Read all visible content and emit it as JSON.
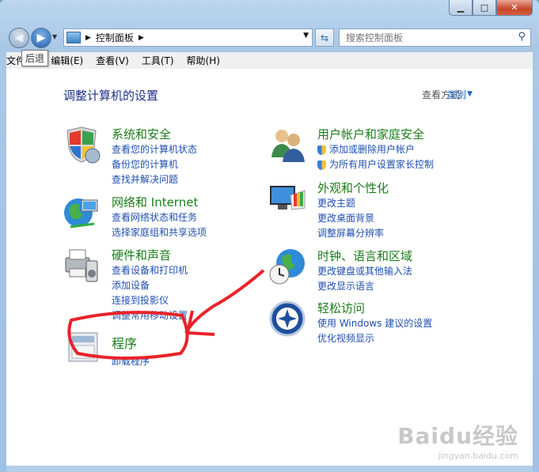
{
  "window": {
    "title_controls": {
      "minimize": "▁",
      "maximize": "□",
      "close": "✕"
    }
  },
  "nav": {
    "back_tooltip": "后退",
    "breadcrumb_root": "控制面板",
    "search_placeholder": "搜索控制面板"
  },
  "menubar": {
    "items": [
      "文件(F)",
      "编辑(E)",
      "查看(V)",
      "工具(T)",
      "帮助(H)"
    ]
  },
  "content": {
    "heading": "调整计算机的设置",
    "view_by_label": "查看方式:",
    "view_by_value": "类别"
  },
  "categories": {
    "system": {
      "title": "系统和安全",
      "links": [
        "查看您的计算机状态",
        "备份您的计算机",
        "查找并解决问题"
      ]
    },
    "network": {
      "title": "网络和 Internet",
      "links": [
        "查看网络状态和任务",
        "选择家庭组和共享选项"
      ]
    },
    "hardware": {
      "title": "硬件和声音",
      "links": [
        "查看设备和打印机",
        "添加设备",
        "连接到投影仪",
        "调整常用移动设置"
      ]
    },
    "programs": {
      "title": "程序",
      "links": [
        "卸载程序"
      ]
    },
    "users": {
      "title": "用户帐户和家庭安全",
      "links": [
        "添加或删除用户帐户",
        "为所有用户设置家长控制"
      ]
    },
    "appearance": {
      "title": "外观和个性化",
      "links": [
        "更改主题",
        "更改桌面背景",
        "调整屏幕分辨率"
      ]
    },
    "clock": {
      "title": "时钟、语言和区域",
      "links": [
        "更改键盘或其他输入法",
        "更改显示语言"
      ]
    },
    "ease": {
      "title": "轻松访问",
      "links": [
        "使用 Windows 建议的设置",
        "优化视频显示"
      ]
    }
  },
  "watermark": {
    "brand": "Baidu经验",
    "url": "jingyan.baidu.com"
  },
  "colors": {
    "category_title": "#1a7c1a",
    "link": "#1f4fb0",
    "heading": "#1e3287",
    "annotation": "#e8232a"
  }
}
